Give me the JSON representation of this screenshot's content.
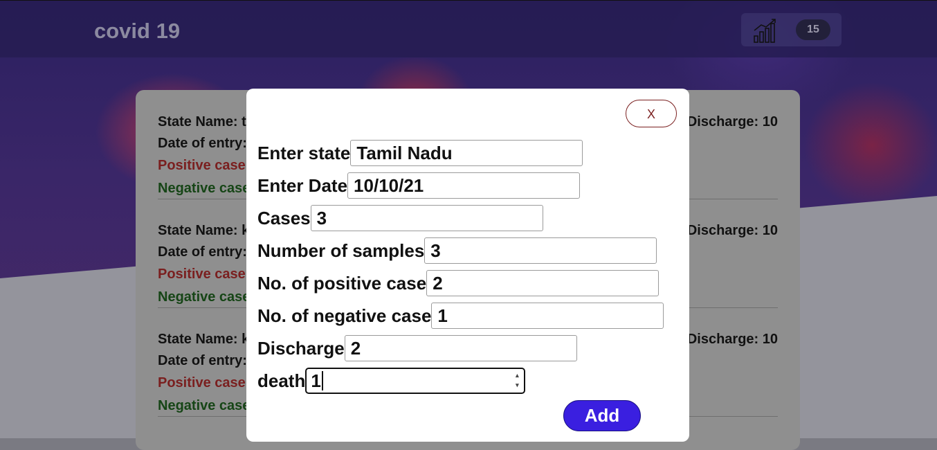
{
  "nav": {
    "brand": "covid 19",
    "count": "15",
    "chart_icon": "bar-chart-trend-icon"
  },
  "entries": [
    {
      "state": "State Name: ta",
      "date": "Date of entry:",
      "positive": "Positive case",
      "negative": "Negative case",
      "discharge": "Discharge: 10"
    },
    {
      "state": "State Name: k",
      "date": "Date of entry:",
      "positive": "Positive case",
      "negative": "Negative case",
      "discharge": "Discharge: 10"
    },
    {
      "state": "State Name: k",
      "date": "Date of entry:",
      "positive": "Positive case",
      "negative": "Negative case",
      "discharge": "Discharge: 10"
    }
  ],
  "modal": {
    "close_label": "X",
    "fields": [
      {
        "label": "Enter state",
        "value": "Tamil Nadu"
      },
      {
        "label": "Enter Date",
        "value": "10/10/21"
      },
      {
        "label": "Cases",
        "value": "3"
      },
      {
        "label": "Number of samples",
        "value": "3"
      },
      {
        "label": "No. of positive case",
        "value": "2"
      },
      {
        "label": "No. of negative case",
        "value": "1"
      },
      {
        "label": "Discharge",
        "value": "2"
      },
      {
        "label": "death",
        "value": "1"
      }
    ],
    "add_label": "Add"
  },
  "colors": {
    "accent": "#3a1fe0",
    "danger": "#7a1f1f",
    "positive_text": "#7a1f1f",
    "negative_text": "#164516"
  }
}
